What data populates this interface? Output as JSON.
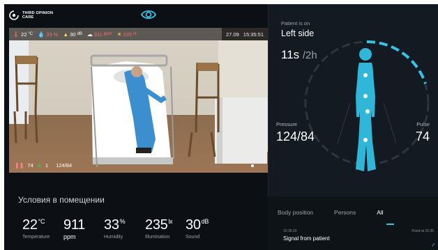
{
  "brand": {
    "name_line1": "THIRD OPINION",
    "name_line2": "CARE"
  },
  "colors": {
    "accent": "#35c4e3",
    "background": "#0c1015",
    "panel": "#141a21"
  },
  "icons": {
    "header_center": "eye-icon",
    "logo": "logo-icon"
  },
  "camera": {
    "sensors": [
      {
        "icon": "thermometer-icon",
        "value": "22",
        "unit": "°C",
        "color": "#ffffff"
      },
      {
        "icon": "drop-icon",
        "value": "33",
        "unit": "%",
        "color": "#ff6a6a"
      },
      {
        "icon": "sound-icon",
        "value": "30",
        "unit": "dB",
        "color": "#ffffff"
      },
      {
        "icon": "cloud-icon",
        "value": "911",
        "unit": "ppm",
        "color": "#ff6a6a"
      },
      {
        "icon": "sun-icon",
        "value": "235",
        "unit": "lx",
        "color": "#ff6a6a"
      }
    ],
    "date": "27.09",
    "time": "15:35:51",
    "bottom": {
      "count_a": "74",
      "count_b": "1",
      "pressure": "124/84"
    }
  },
  "room": {
    "title": "Условия в помещении",
    "metrics": [
      {
        "value": "22",
        "unit": "°C",
        "label": "Temperature"
      },
      {
        "value": "911",
        "unit": "",
        "label": "ppm"
      },
      {
        "value": "33",
        "unit": "%",
        "label": "Humidity"
      },
      {
        "value": "235",
        "unit": "lx",
        "label": "Illumination"
      },
      {
        "value": "30",
        "unit": "dB",
        "label": "Sound"
      }
    ]
  },
  "patient": {
    "label": "Patient is on",
    "position": "Left side",
    "duration": "11s",
    "duration_of": "/2h",
    "pressure_label": "Pressure",
    "pressure": "124/84",
    "pulse_label": "Pulse",
    "pulse": "74"
  },
  "events": {
    "tabs": [
      "Body position",
      "Persons",
      "All"
    ],
    "active_tab": "All",
    "item": {
      "time": "15:35:10",
      "fixed": "Fixed at 15:35",
      "text": "Signal from patient"
    }
  }
}
